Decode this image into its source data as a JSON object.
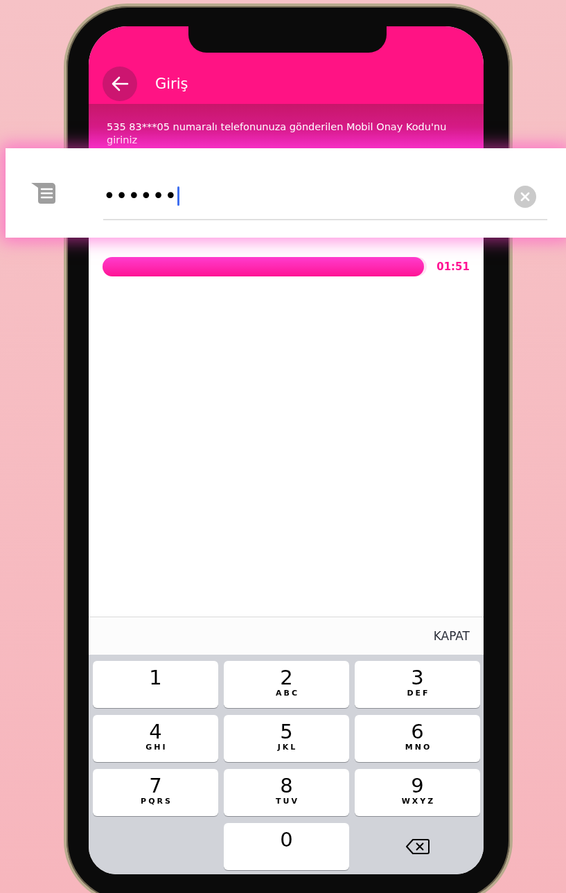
{
  "header": {
    "title": "Giriş"
  },
  "message": "535 83***05 numaralı telefonunuza gönderilen Mobil Onay Kodu'nu giriniz",
  "code_field": {
    "value": "••••••"
  },
  "timer": {
    "level": 0.99,
    "reading": "01:51"
  },
  "keyboard_toolbar": {
    "close_label": "KAPAT"
  },
  "keypad": [
    {
      "kind": "digit",
      "digit": "1"
    },
    {
      "kind": "digit",
      "digit": "2",
      "letters": "ABC"
    },
    {
      "kind": "digit",
      "digit": "3",
      "letters": "DEF"
    },
    {
      "kind": "digit",
      "digit": "4",
      "letters": "GHI"
    },
    {
      "kind": "digit",
      "digit": "5",
      "letters": "JKL"
    },
    {
      "kind": "digit",
      "digit": "6",
      "letters": "MNO"
    },
    {
      "kind": "digit",
      "digit": "7",
      "letters": "PQRS"
    },
    {
      "kind": "digit",
      "digit": "8",
      "letters": "TUV"
    },
    {
      "kind": "digit",
      "digit": "9",
      "letters": "WXYZ"
    },
    {
      "kind": "empty"
    },
    {
      "kind": "digit",
      "digit": "0"
    },
    {
      "kind": "backspace"
    }
  ]
}
